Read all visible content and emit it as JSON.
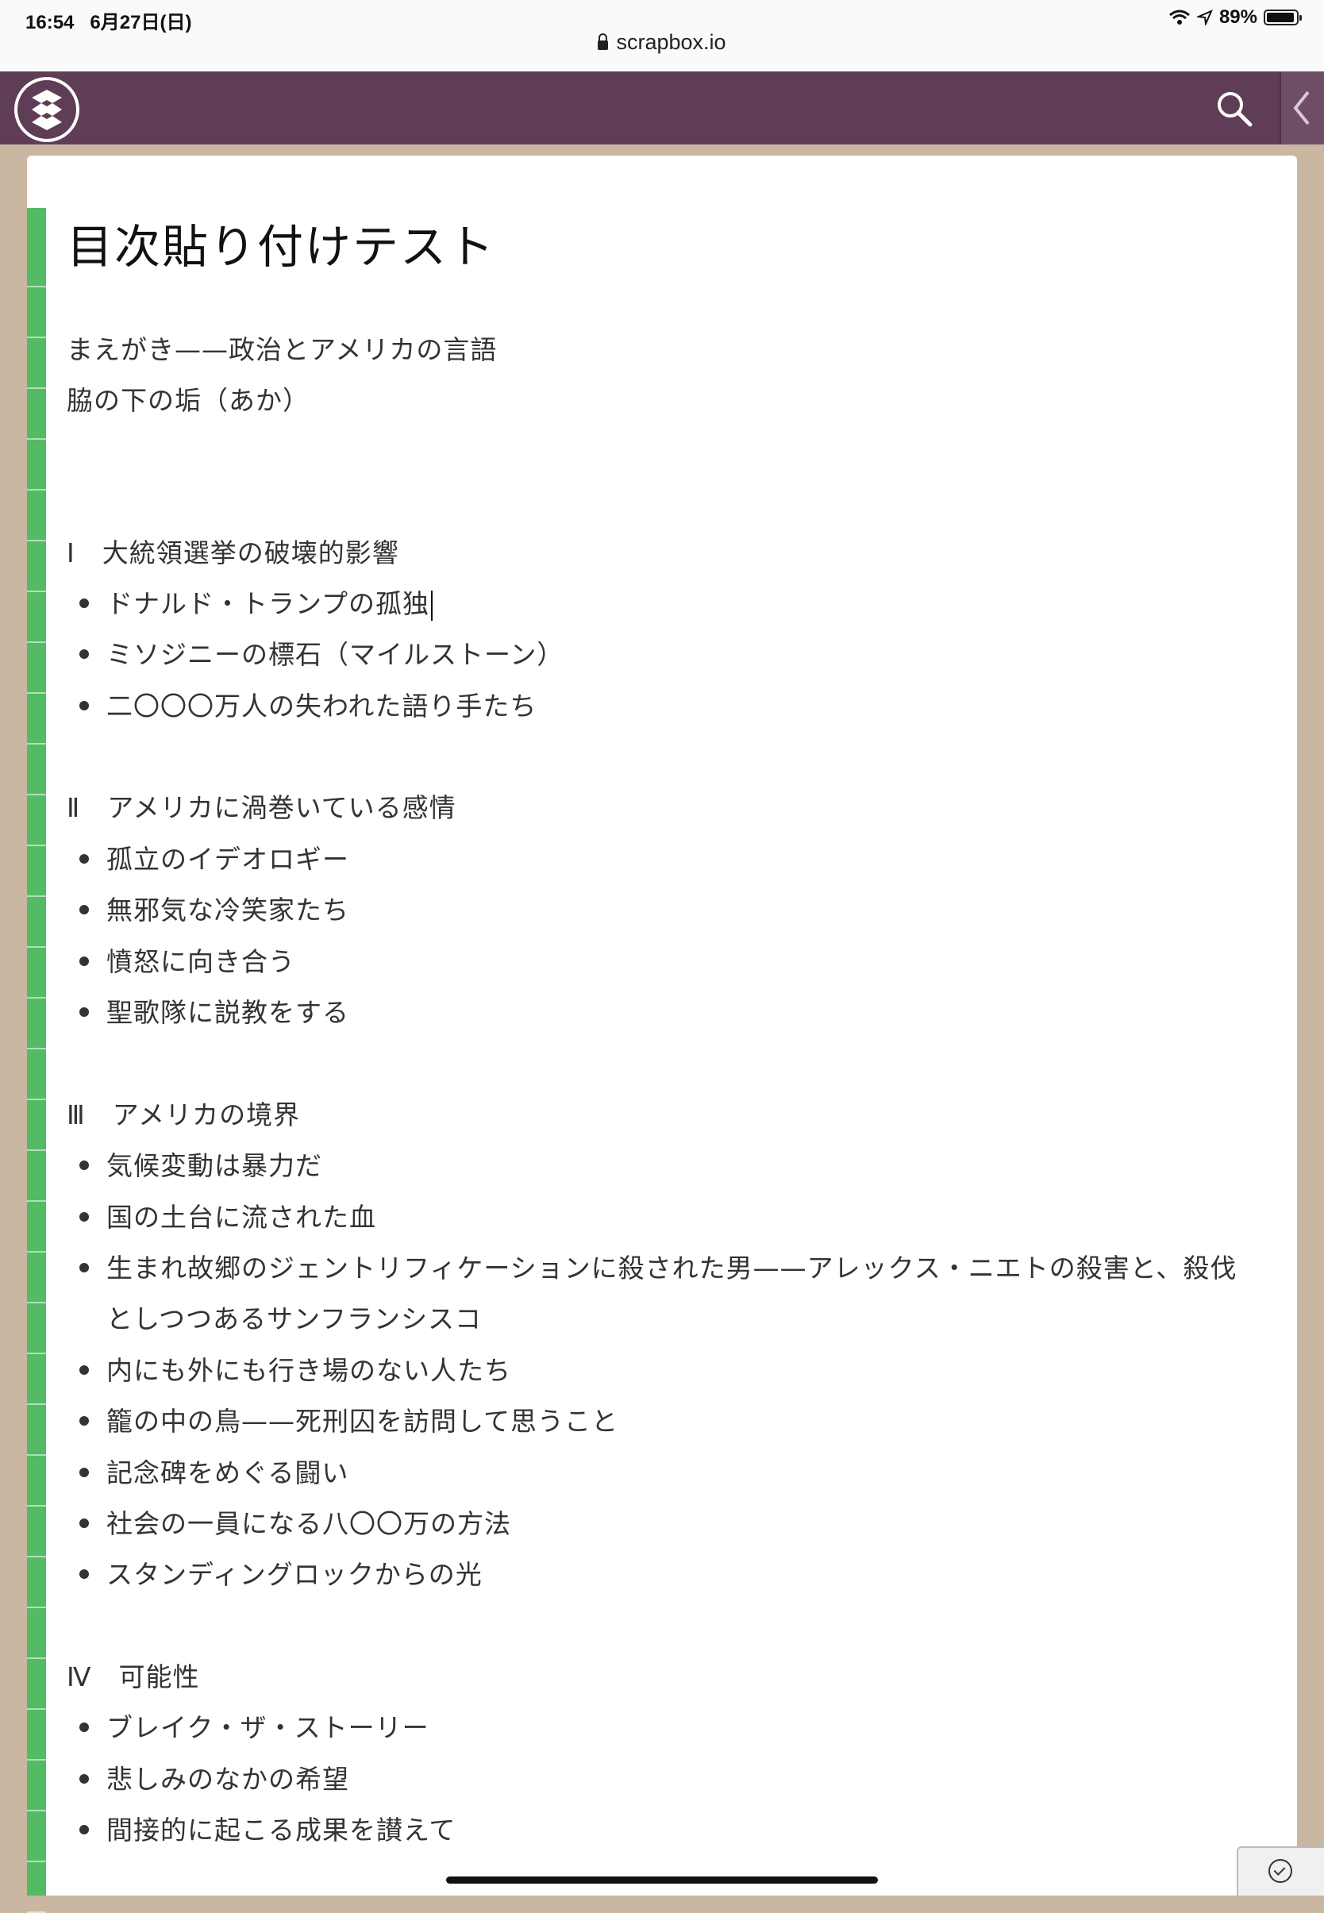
{
  "status_bar": {
    "time": "16:54",
    "date": "6月27日(日)",
    "battery": "89%"
  },
  "url_bar": {
    "host": "scrapbox.io"
  },
  "header": {
    "brand_color": "#5f3d56"
  },
  "page": {
    "title": "目次貼り付けテスト",
    "lines": {
      "intro1": "まえがき——政治とアメリカの言語",
      "intro2": "脇の下の垢（あか）",
      "s1": "Ⅰ　大統領選挙の破壊的影響",
      "s1_1": "ドナルド・トランプの孤独",
      "s1_2": "ミソジニーの標石（マイルストーン）",
      "s1_3": "二〇〇〇万人の失われた語り手たち",
      "s2": "Ⅱ　アメリカに渦巻いている感情",
      "s2_1": "孤立のイデオロギー",
      "s2_2": "無邪気な冷笑家たち",
      "s2_3": "憤怒に向き合う",
      "s2_4": "聖歌隊に説教をする",
      "s3": "Ⅲ　アメリカの境界",
      "s3_1": "気候変動は暴力だ",
      "s3_2": "国の土台に流された血",
      "s3_3a": "生まれ故郷のジェントリフィケーションに殺された男——アレックス・ニエトの殺害と、殺伐",
      "s3_3b": "としつつあるサンフランシスコ",
      "s3_4": "内にも外にも行き場のない人たち",
      "s3_5": "籠の中の鳥——死刑囚を訪問して思うこと",
      "s3_6": "記念碑をめぐる闘い",
      "s3_7": "社会の一員になる八〇〇万の方法",
      "s3_8": "スタンディングロックからの光",
      "s4": "Ⅳ　可能性",
      "s4_1": "ブレイク・ザ・ストーリー",
      "s4_2": "悲しみのなかの希望",
      "s4_3": "間接的に起こる成果を讃えて"
    }
  },
  "colors": {
    "gutter": "#52bb63",
    "background": "#c9b7a2"
  }
}
